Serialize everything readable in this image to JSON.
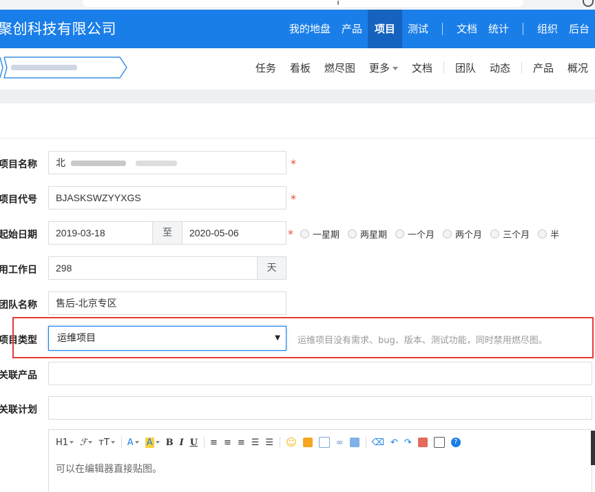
{
  "header": {
    "company": "聚创科技有限公司",
    "nav": [
      "我的地盘",
      "产品",
      "项目",
      "测试",
      "文档",
      "统计",
      "组织",
      "后台"
    ],
    "active_nav": "项目"
  },
  "subnav": {
    "items": [
      "任务",
      "看板",
      "燃尽图",
      "更多",
      "文档",
      "团队",
      "动态",
      "产品",
      "概况"
    ]
  },
  "form": {
    "name": {
      "label": "项目名称",
      "value": "北"
    },
    "code": {
      "label": "项目代号",
      "value": "BJASKSWZYYXGS"
    },
    "dates": {
      "label": "起始日期",
      "start": "2019-03-18",
      "to": "至",
      "end": "2020-05-06",
      "options": [
        "一星期",
        "两星期",
        "一个月",
        "两个月",
        "三个月",
        "半"
      ]
    },
    "workdays": {
      "label": "可用工作日",
      "value": "298",
      "unit": "天"
    },
    "team": {
      "label": "团队名称",
      "value": "售后-北京专区"
    },
    "type": {
      "label": "项目类型",
      "value": "运维项目",
      "hint": "运维项目没有需求、bug、版本、测试功能，同时禁用燃尽图。"
    },
    "products": {
      "label": "关联产品"
    },
    "plans": {
      "label": "关联计划"
    },
    "editor": {
      "placeholder": "可以在编辑器直接贴图。"
    }
  },
  "colors": {
    "primary": "#1a7ee8",
    "required": "#e74c3c",
    "highlight": "#e53935"
  }
}
